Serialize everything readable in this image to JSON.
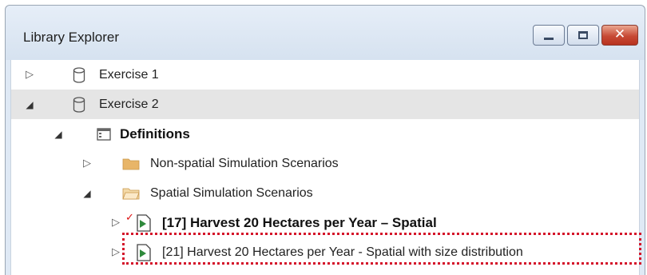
{
  "window": {
    "title": "Library Explorer",
    "buttons": {
      "minimize": "minimize",
      "maximize": "maximize",
      "close": "✕"
    }
  },
  "tree": {
    "exercise1": {
      "label": "Exercise 1",
      "icon": "database-icon",
      "expanded": false
    },
    "exercise2": {
      "label": "Exercise 2",
      "icon": "database-icon",
      "expanded": true,
      "selected": true
    },
    "definitions": {
      "label": "Definitions",
      "icon": "definitions-icon",
      "expanded": true
    },
    "nonspatial": {
      "label": "Non-spatial Simulation Scenarios",
      "icon": "folder-closed-icon",
      "expanded": false
    },
    "spatial": {
      "label": "Spatial Simulation Scenarios",
      "icon": "folder-open-icon",
      "expanded": true
    },
    "scenario17": {
      "label": "[17] Harvest 20 Hectares per Year – Spatial",
      "icon": "scenario-icon",
      "checked": true,
      "bold": true
    },
    "scenario21": {
      "label": "[21] Harvest 20 Hectares per Year - Spatial with size distribution",
      "icon": "scenario-icon",
      "highlighted": true
    }
  },
  "colors": {
    "selection": "#e5e5e5",
    "highlight_border": "#d4142a",
    "checkmark": "#dd1111",
    "folder": "#e8b568"
  }
}
